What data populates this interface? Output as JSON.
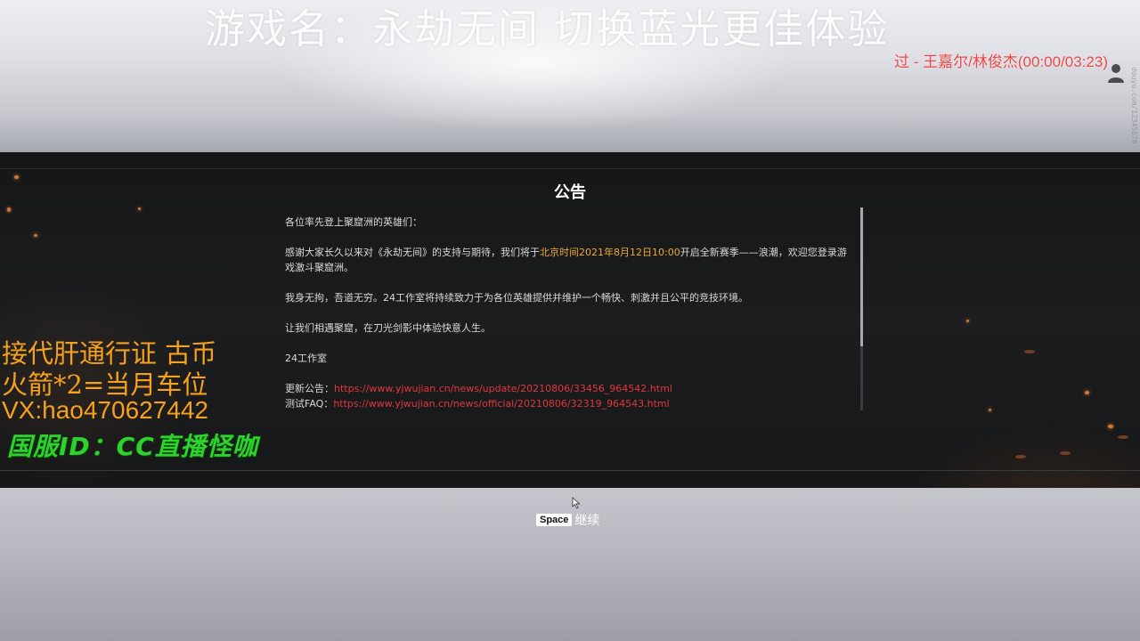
{
  "overlay": {
    "stream_title": "游戏名：永劫无间  切换蓝光更佳体验",
    "music_tag": "过 - 王嘉尔/林俊杰(00:00/03:23)",
    "side_watermark": "douyu.com/12345678",
    "promo_lines": [
      "接代肝通行证 古币",
      "火箭*2=当月车位",
      "VX:hao470627442",
      "国服ID：CC直播怪咖"
    ]
  },
  "announcement": {
    "title": "公告",
    "greeting": "各位率先登上聚窟洲的英雄们：",
    "para1_prefix": "感谢大家长久以来对《永劫无间》的支持与期待，我们将于",
    "para1_highlight": "北京时间2021年8月12日10:00",
    "para1_suffix": "开启全新赛季——浪潮，欢迎您登录游戏激斗聚窟洲。",
    "para2": "我身无拘，吾道无穷。24工作室将持续致力于为各位英雄提供并维护一个畅快、刺激并且公平的竞技环境。",
    "para3": "让我们相遇聚窟，在刀光剑影中体验快意人生。",
    "signature": "24工作室",
    "update_label": "更新公告：",
    "update_link": "https://www.yjwujian.cn/news/update/20210806/33456_964542.html",
    "faq_label": "测试FAQ：",
    "faq_link": "https://www.yjwujian.cn/news/official/20210806/32319_964543.html"
  },
  "footer": {
    "key_label": "Space",
    "continue_label": "继续"
  },
  "colors": {
    "highlight": "#f0a832",
    "link": "#e2373b",
    "promo_orange": "#f5a11e",
    "promo_green": "#2ed12e",
    "music_red": "#ef4747"
  }
}
